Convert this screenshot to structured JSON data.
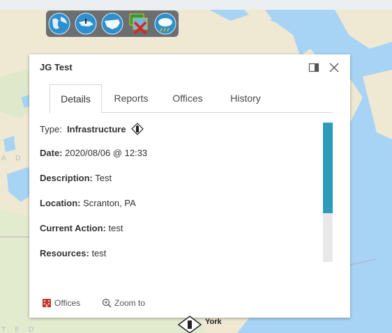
{
  "map": {
    "labels": [
      "A D A",
      "T E D"
    ]
  },
  "toolbar": {
    "buttons": [
      {
        "icon": "globe-icon"
      },
      {
        "icon": "state-map-icon"
      },
      {
        "icon": "us-map-icon"
      },
      {
        "icon": "layer-off-icon"
      },
      {
        "icon": "weather-icon"
      }
    ]
  },
  "popup": {
    "title": "JG Test",
    "tabs": [
      "Details",
      "Reports",
      "Offices",
      "History"
    ],
    "active_tab": "Details",
    "fields": {
      "type_label": "Type:",
      "type_value": "Infrastructure",
      "date_label": "Date:",
      "date_value": "2020/08/06 @ 12:33",
      "description_label": "Description:",
      "description_value": "Test",
      "location_label": "Location:",
      "location_value": "Scranton, PA",
      "action_label": "Current Action:",
      "action_value": "test",
      "resources_label": "Resources:",
      "resources_value": "test"
    },
    "footer": {
      "offices_label": "Offices",
      "zoom_label": "Zoom to"
    },
    "scroll_fraction": 0.65
  },
  "marker": {
    "label": "York"
  },
  "colors": {
    "water": "#a7d4f5",
    "land": "#efe8d2",
    "accent": "#2e9bb8"
  }
}
